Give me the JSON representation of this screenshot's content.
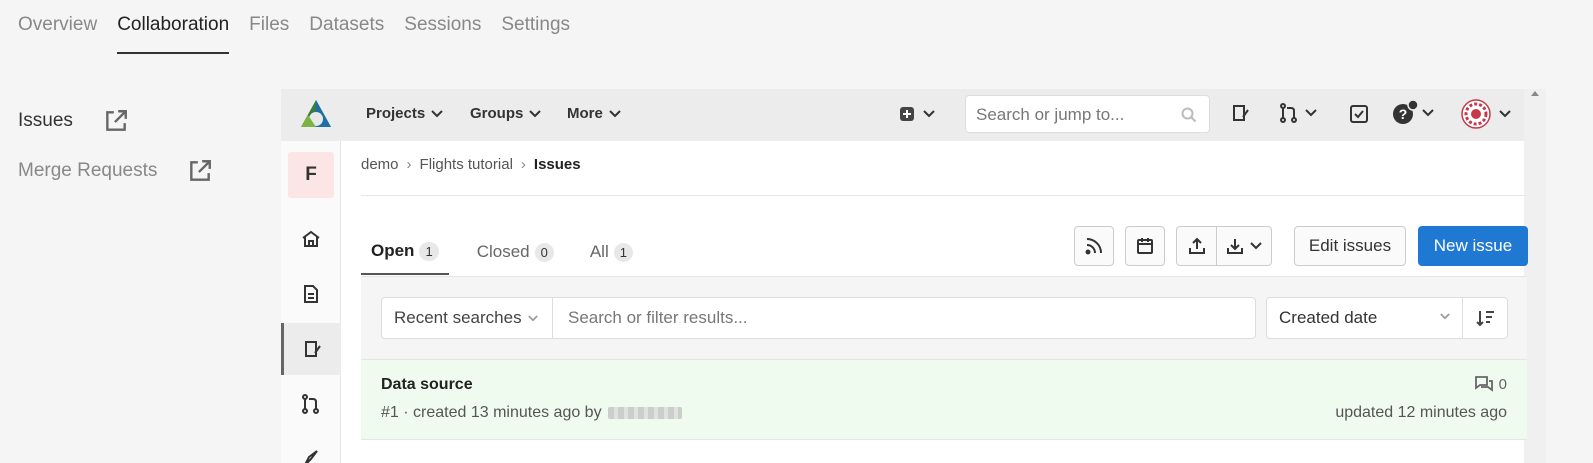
{
  "top_tabs": [
    "Overview",
    "Collaboration",
    "Files",
    "Datasets",
    "Sessions",
    "Settings"
  ],
  "left_links": {
    "issues": "Issues",
    "merge_requests": "Merge Requests"
  },
  "gitlab_nav": {
    "projects": "Projects",
    "groups": "Groups",
    "more": "More",
    "search_placeholder": "Search or jump to..."
  },
  "project_avatar": "F",
  "breadcrumb": {
    "a": "demo",
    "b": "Flights tutorial",
    "c": "Issues"
  },
  "issue_tabs": {
    "open": "Open",
    "open_count": "1",
    "closed": "Closed",
    "closed_count": "0",
    "all": "All",
    "all_count": "1"
  },
  "buttons": {
    "edit": "Edit issues",
    "new": "New issue"
  },
  "filter": {
    "recent": "Recent searches",
    "placeholder": "Search or filter results...",
    "sort": "Created date"
  },
  "issue": {
    "title": "Data source",
    "meta": "#1 · created 13 minutes ago by",
    "comments": "0",
    "updated": "updated 12 minutes ago"
  },
  "colors": {
    "primary": "#1f78d1",
    "issue_bg": "#f0fbf0",
    "avatar_bg": "#fbe5e5"
  }
}
